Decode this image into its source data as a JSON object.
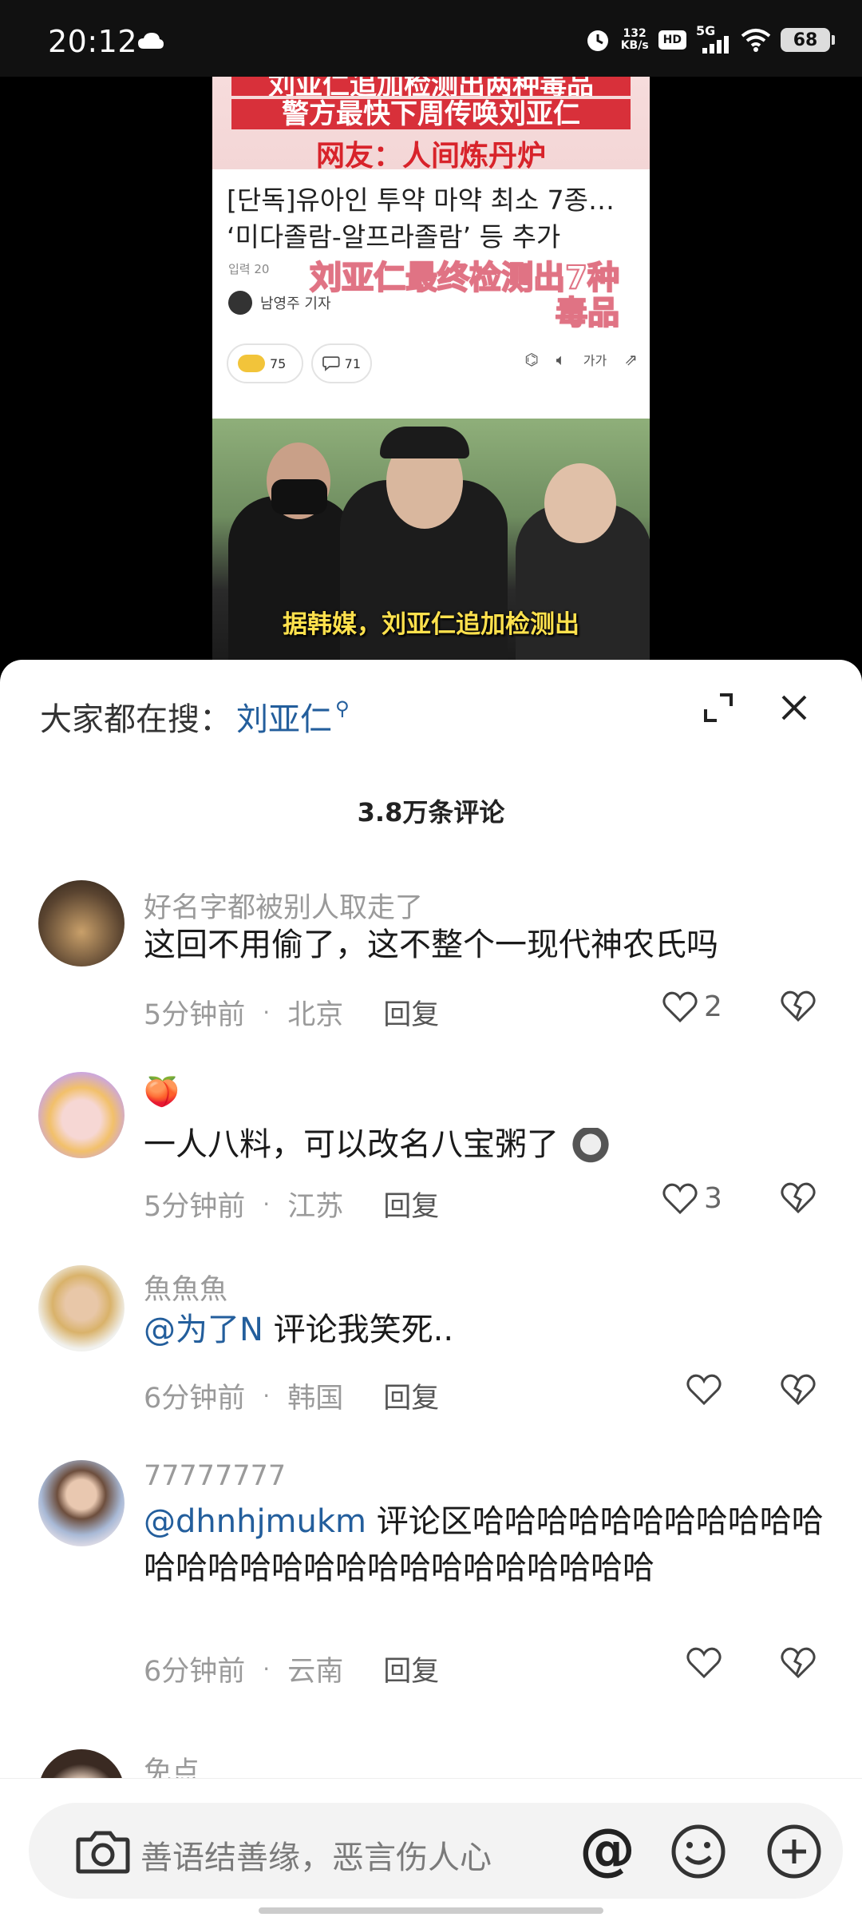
{
  "status_bar": {
    "time": "20:12",
    "net_speed_value": "132",
    "net_speed_unit": "KB/s",
    "hd_label": "HD",
    "signal_label": "5G",
    "battery": "68"
  },
  "video": {
    "headline_line1": "刘亚仁追加检测出两种毒品",
    "headline_line2": "警方最快下周传唤刘亚仁",
    "headline_line3": "网友：人间炼丹炉",
    "article_title_line1": "[단독]유아인 투약 마약 최소 7종…",
    "article_title_line2": "‘미다졸람-알프라졸람’ 등 추가",
    "article_meta": "입력 20",
    "overlay_line1": "刘亚仁最终检测出7种",
    "overlay_line2": "毒品",
    "reporter_name": "남영주 기자",
    "reaction_count": "75",
    "comment_count": "71",
    "font_size_label": "가가",
    "subtitle": "据韩媒，刘亚仁追加检测出"
  },
  "sheet": {
    "search_prefix": "大家都在搜：",
    "search_term": "刘亚仁",
    "comment_count_label": "3.8万条评论"
  },
  "comments": [
    {
      "name": "好名字都被别人取走了",
      "text": "这回不用偷了，这不整个一现代神农氏吗",
      "time": "5分钟前",
      "location": "北京",
      "reply": "回复",
      "likes": "2"
    },
    {
      "name": "🍑",
      "text": "一人八料，可以改名八宝粥了",
      "time": "5分钟前",
      "location": "江苏",
      "reply": "回复",
      "likes": "3"
    },
    {
      "name": "魚魚魚",
      "mention": "@为了N",
      "text": " 评论我笑死..",
      "time": "6分钟前",
      "location": "韩国",
      "reply": "回复",
      "likes": ""
    },
    {
      "name": "77777777",
      "mention": "@dhnhjmukm",
      "text": " 评论区哈哈哈哈哈哈哈哈哈哈哈哈哈哈哈哈哈哈哈哈哈哈哈哈哈哈哈",
      "time": "6分钟前",
      "location": "云南",
      "reply": "回复",
      "likes": ""
    },
    {
      "name": "免点"
    }
  ],
  "input": {
    "placeholder": "善语结善缘，恶言伤人心",
    "at_symbol": "@"
  }
}
